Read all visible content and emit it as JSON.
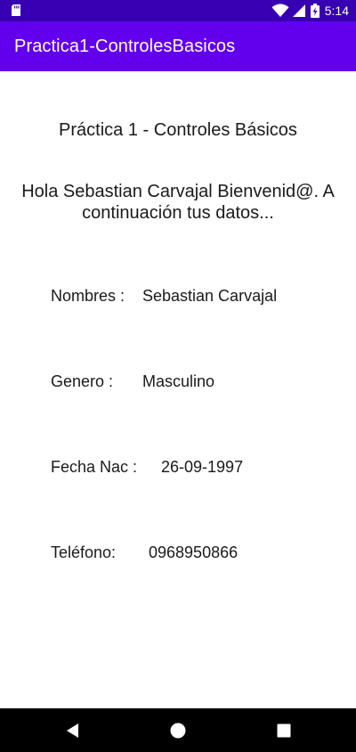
{
  "status_bar": {
    "time": "5:14",
    "icons": [
      "sd-card-icon",
      "wifi-icon",
      "signal-icon",
      "battery-charging-icon"
    ]
  },
  "app_bar": {
    "title": "Practica1-ControlesBasicos",
    "color": "#6200ee",
    "status_color": "#3700b3"
  },
  "main": {
    "heading": "Práctica 1 - Controles Básicos",
    "greeting": "Hola Sebastian Carvajal Bienvenid@. A continuación tus datos...",
    "fields": {
      "nombres": {
        "label": "Nombres :",
        "value": "Sebastian Carvajal"
      },
      "genero": {
        "label": "Genero :",
        "value": "Masculino"
      },
      "fecha_nac": {
        "label": "Fecha Nac :",
        "value": "26-09-1997"
      },
      "telefono": {
        "label": "Teléfono:",
        "value": "0968950866"
      }
    }
  },
  "nav_bar": {
    "buttons": [
      "back-icon",
      "home-icon",
      "recents-icon"
    ]
  }
}
